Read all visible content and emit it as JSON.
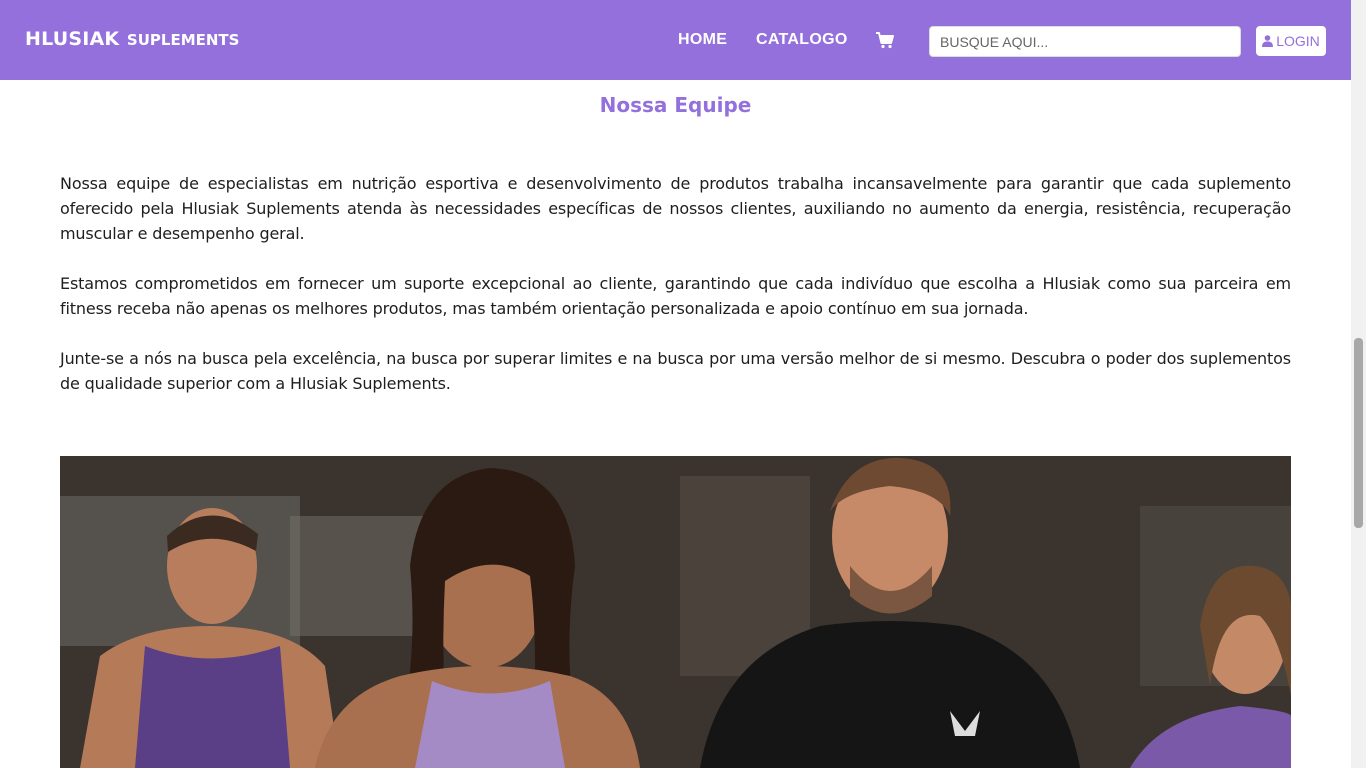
{
  "brand": {
    "main": "HLUSIAK",
    "sub": "SUPLEMENTS"
  },
  "nav": {
    "home": "HOME",
    "catalog": "CATALOGO",
    "cart_icon": "shopping-cart-icon"
  },
  "search": {
    "placeholder": "BUSQUE AQUI...",
    "value": ""
  },
  "login": {
    "label": "LOGIN",
    "icon": "user-icon"
  },
  "section": {
    "title": "Nossa Equipe",
    "paragraphs": [
      "Nossa equipe de especialistas em nutrição esportiva e desenvolvimento de produtos trabalha incansavelmente para garantir que cada suplemento oferecido pela Hlusiak Suplements atenda às necessidades específicas de nossos clientes, auxiliando no aumento da energia, resistência, recuperação muscular e desempenho geral.",
      "Estamos comprometidos em fornecer um suporte excepcional ao cliente, garantindo que cada indivíduo que escolha a Hlusiak como sua parceira em fitness receba não apenas os melhores produtos, mas também orientação personalizada e apoio contínuo em sua jornada.",
      "Junte-se a nós na busca pela excelência, na busca por superar limites e na busca por uma versão melhor de si mesmo. Descubra o poder dos suplementos de qualidade superior com a Hlusiak Suplements."
    ]
  },
  "colors": {
    "accent": "#9370db",
    "text": "#1e1e1e",
    "background": "#ffffff"
  }
}
